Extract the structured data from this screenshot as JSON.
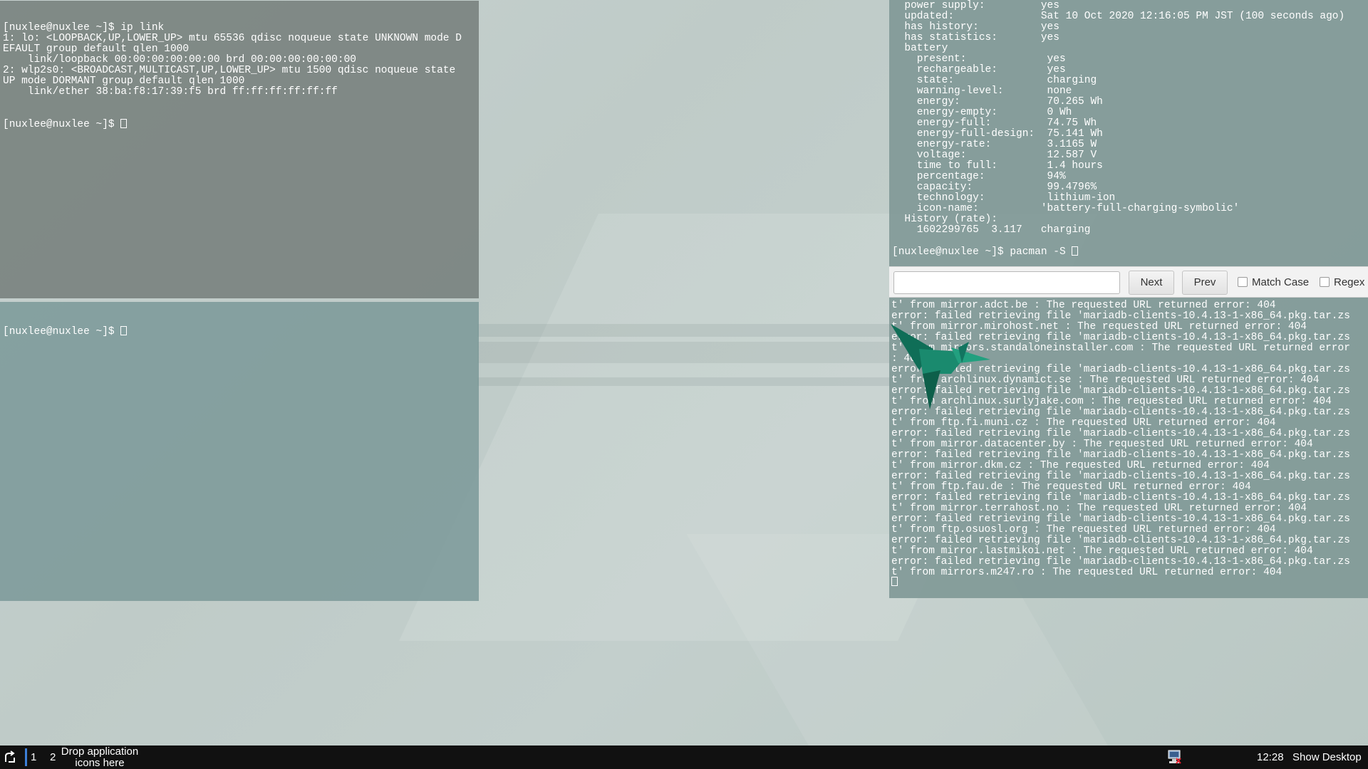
{
  "terminals": {
    "top_left": {
      "lines": [
        "[nuxlee@nuxlee ~]$ ip link",
        "1: lo: <LOOPBACK,UP,LOWER_UP> mtu 65536 qdisc noqueue state UNKNOWN mode D",
        "EFAULT group default qlen 1000",
        "    link/loopback 00:00:00:00:00:00 brd 00:00:00:00:00:00",
        "2: wlp2s0: <BROADCAST,MULTICAST,UP,LOWER_UP> mtu 1500 qdisc noqueue state",
        "UP mode DORMANT group default qlen 1000",
        "    link/ether 38:ba:f8:17:39:f5 brd ff:ff:ff:ff:ff:ff"
      ],
      "prompt": "[nuxlee@nuxlee ~]$ "
    },
    "bottom_left": {
      "prompt": "[nuxlee@nuxlee ~]$ "
    },
    "right": {
      "top_lines": [
        "  power supply:         yes",
        "  updated:              Sat 10 Oct 2020 12:16:05 PM JST (100 seconds ago)",
        "  has history:          yes",
        "  has statistics:       yes",
        "  battery",
        "    present:             yes",
        "    rechargeable:        yes",
        "    state:               charging",
        "    warning-level:       none",
        "    energy:              70.265 Wh",
        "    energy-empty:        0 Wh",
        "    energy-full:         74.75 Wh",
        "    energy-full-design:  75.141 Wh",
        "    energy-rate:         3.1165 W",
        "    voltage:             12.587 V",
        "    time to full:        1.4 hours",
        "    percentage:          94%",
        "    capacity:            99.4796%",
        "    technology:          lithium-ion",
        "    icon-name:          'battery-full-charging-symbolic'",
        "  History (rate):",
        "    1602299765  3.117   charging"
      ],
      "prompt": "[nuxlee@nuxlee ~]$ pacman -S ",
      "error_lines": [
        "t' from mirror.adct.be : The requested URL returned error: 404",
        "error: failed retrieving file 'mariadb-clients-10.4.13-1-x86_64.pkg.tar.zs",
        "t' from mirror.mirohost.net : The requested URL returned error: 404",
        "error: failed retrieving file 'mariadb-clients-10.4.13-1-x86_64.pkg.tar.zs",
        "t' from mirrors.standaloneinstaller.com : The requested URL returned error",
        ": 404",
        "error: failed retrieving file 'mariadb-clients-10.4.13-1-x86_64.pkg.tar.zs",
        "t' from archlinux.dynamict.se : The requested URL returned error: 404",
        "error: failed retrieving file 'mariadb-clients-10.4.13-1-x86_64.pkg.tar.zs",
        "t' from archlinux.surlyjake.com : The requested URL returned error: 404",
        "error: failed retrieving file 'mariadb-clients-10.4.13-1-x86_64.pkg.tar.zs",
        "t' from ftp.fi.muni.cz : The requested URL returned error: 404",
        "error: failed retrieving file 'mariadb-clients-10.4.13-1-x86_64.pkg.tar.zs",
        "t' from mirror.datacenter.by : The requested URL returned error: 404",
        "error: failed retrieving file 'mariadb-clients-10.4.13-1-x86_64.pkg.tar.zs",
        "t' from mirror.dkm.cz : The requested URL returned error: 404",
        "error: failed retrieving file 'mariadb-clients-10.4.13-1-x86_64.pkg.tar.zs",
        "t' from ftp.fau.de : The requested URL returned error: 404",
        "error: failed retrieving file 'mariadb-clients-10.4.13-1-x86_64.pkg.tar.zs",
        "t' from mirror.terrahost.no : The requested URL returned error: 404",
        "error: failed retrieving file 'mariadb-clients-10.4.13-1-x86_64.pkg.tar.zs",
        "t' from ftp.osuosl.org : The requested URL returned error: 404",
        "error: failed retrieving file 'mariadb-clients-10.4.13-1-x86_64.pkg.tar.zs",
        "t' from mirror.lastmikoi.net : The requested URL returned error: 404",
        "error: failed retrieving file 'mariadb-clients-10.4.13-1-x86_64.pkg.tar.zs",
        "t' from mirrors.m247.ro : The requested URL returned error: 404"
      ]
    }
  },
  "search_bar": {
    "input_value": "",
    "next_label": "Next",
    "prev_label": "Prev",
    "match_case_label": "Match Case",
    "regex_label": "Regex",
    "match_case_checked": false,
    "regex_checked": false
  },
  "taskbar": {
    "workspaces": [
      "1",
      "2"
    ],
    "active_workspace": "1",
    "drop_hint": "Drop application icons here",
    "clock": "12:28",
    "show_desktop": "Show Desktop",
    "launcher_icon": "launcher-icon",
    "tray_icon": "network-icon"
  },
  "colors": {
    "accent": "#3d7fd8",
    "bird": "#1a8a6e",
    "taskbar_bg": "#111111"
  }
}
